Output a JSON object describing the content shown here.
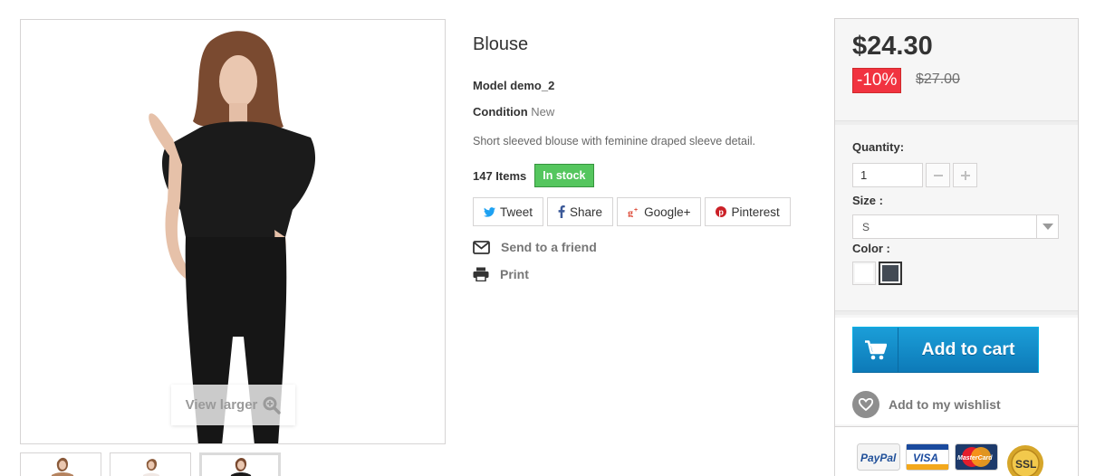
{
  "product": {
    "title": "Blouse",
    "model_label": "Model",
    "model_value": "demo_2",
    "condition_label": "Condition",
    "condition_value": "New",
    "short_description": "Short sleeved blouse with feminine draped sleeve detail.",
    "items_count": "147 Items",
    "stock_status": "In stock"
  },
  "image": {
    "view_larger_label": "View larger"
  },
  "social": [
    {
      "label": "Tweet",
      "icon": "twitter-icon"
    },
    {
      "label": "Share",
      "icon": "facebook-icon"
    },
    {
      "label": "Google+",
      "icon": "google-plus-icon"
    },
    {
      "label": "Pinterest",
      "icon": "pinterest-icon"
    }
  ],
  "links": {
    "send_to_friend": "Send to a friend",
    "print": "Print"
  },
  "pricing": {
    "price": "$24.30",
    "discount": "-10%",
    "old_price": "$27.00"
  },
  "options": {
    "quantity_label": "Quantity:",
    "quantity_value": "1",
    "size_label": "Size :",
    "size_value": "S",
    "color_label": "Color :",
    "colors": [
      "#ffffff",
      "#434a54"
    ]
  },
  "actions": {
    "add_to_cart": "Add to cart",
    "wishlist": "Add to my wishlist"
  },
  "payment": {
    "paypal": "PayPal",
    "visa": "VISA",
    "mastercard": "MasterCard",
    "ssl": "SSL"
  },
  "colors": {
    "accent_blue": "#1b9ed8",
    "discount_red": "#f13340",
    "stock_green": "#55c65e"
  }
}
